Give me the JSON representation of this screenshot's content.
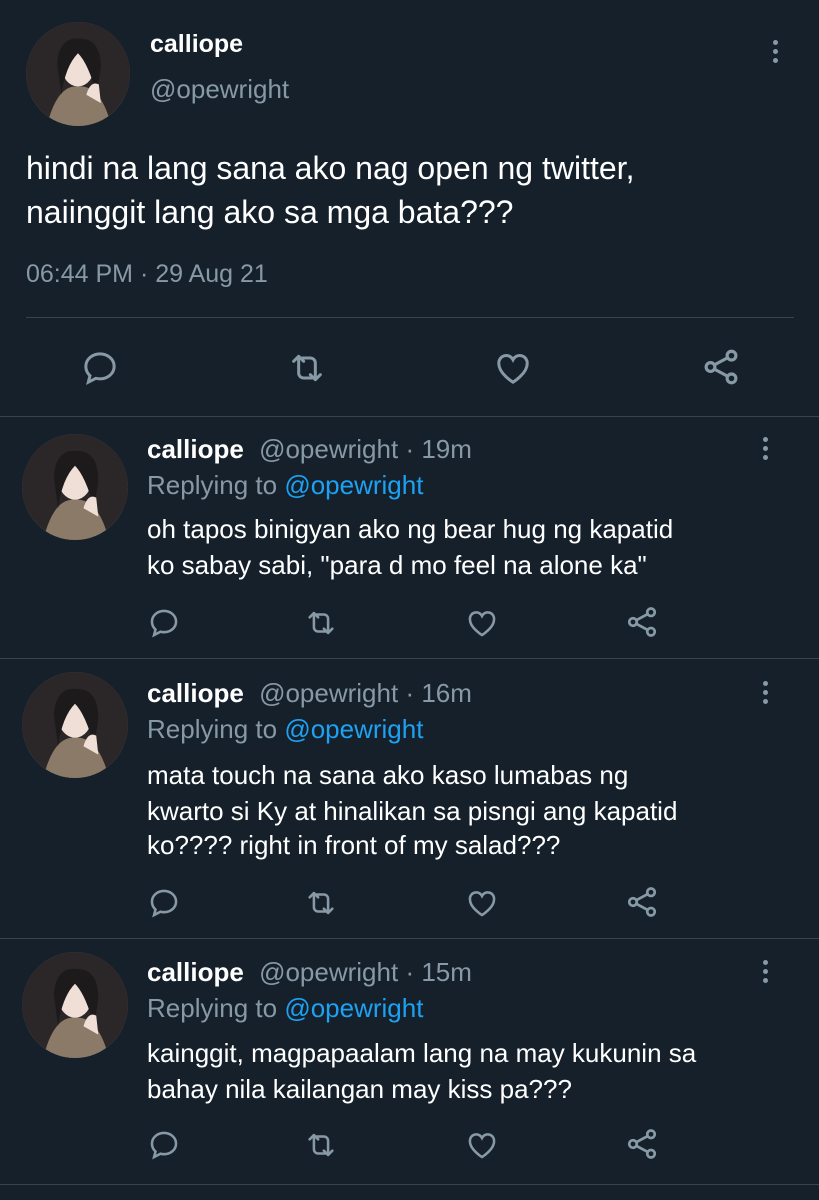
{
  "colors": {
    "background": "#15202b",
    "muted": "#8899a6",
    "link": "#1da1f2",
    "divider": "#38444d"
  },
  "main_tweet": {
    "display_name": "calliope",
    "handle": "@opewright",
    "text_line1": "hindi na lang sana ako nag open ng twitter,",
    "text_line2": "naiinggit lang ako sa mga bata???",
    "timestamp": "06:44 PM · 29 Aug 21"
  },
  "replies": [
    {
      "display_name": "calliope",
      "handle": "@opewright",
      "time": "· 19m",
      "replying_label": "Replying to",
      "replying_to": "@opewright",
      "line1": "oh tapos binigyan ako ng bear hug ng kapatid",
      "line2": "ko sabay sabi, \"para d mo feel na alone ka\"",
      "line3": ""
    },
    {
      "display_name": "calliope",
      "handle": "@opewright",
      "time": "· 16m",
      "replying_label": "Replying to",
      "replying_to": "@opewright",
      "line1": "mata touch na sana ako kaso lumabas ng",
      "line2": "kwarto si Ky at hinalikan sa pisngi ang kapatid",
      "line3": "ko???? right in front of my salad???"
    },
    {
      "display_name": "calliope",
      "handle": "@opewright",
      "time": "· 15m",
      "replying_label": "Replying to",
      "replying_to": "@opewright",
      "line1": "kainggit, magpapaalam lang na may kukunin sa",
      "line2": "bahay nila kailangan may kiss pa???",
      "line3": ""
    }
  ],
  "icons": [
    "reply-icon",
    "retweet-icon",
    "like-icon",
    "share-icon",
    "more-options-icon"
  ]
}
